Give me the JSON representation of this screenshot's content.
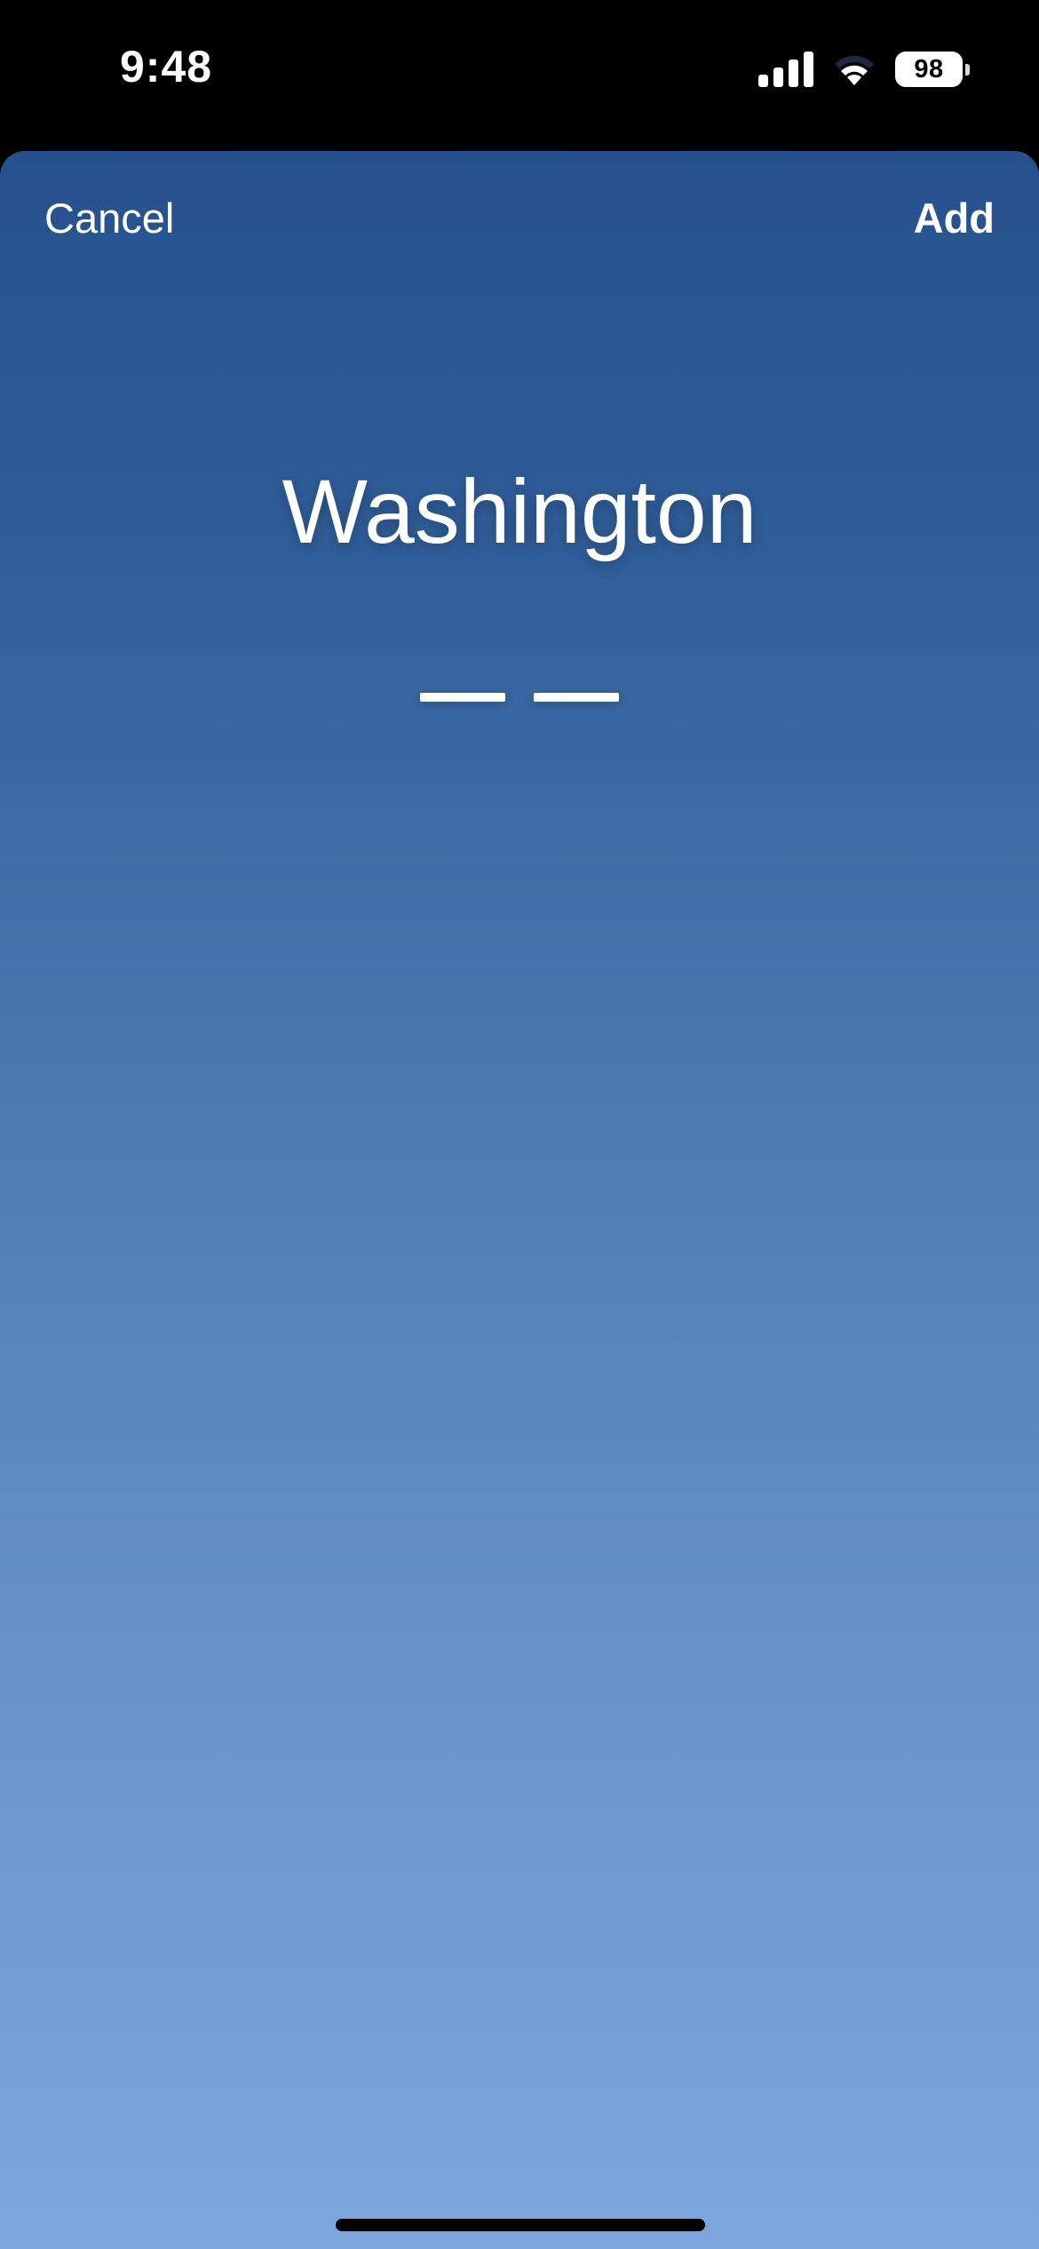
{
  "status_bar": {
    "time": "9:48",
    "battery_level": "98",
    "signal_bars": 4,
    "wifi_icon": "wifi-icon"
  },
  "nav": {
    "cancel_label": "Cancel",
    "add_label": "Add"
  },
  "weather": {
    "city": "Washington",
    "temperature_placeholder": "— —"
  },
  "colors": {
    "sheet_gradient_top": "#26518c",
    "sheet_gradient_bottom": "#7ca6dc",
    "text": "#ffffff"
  }
}
